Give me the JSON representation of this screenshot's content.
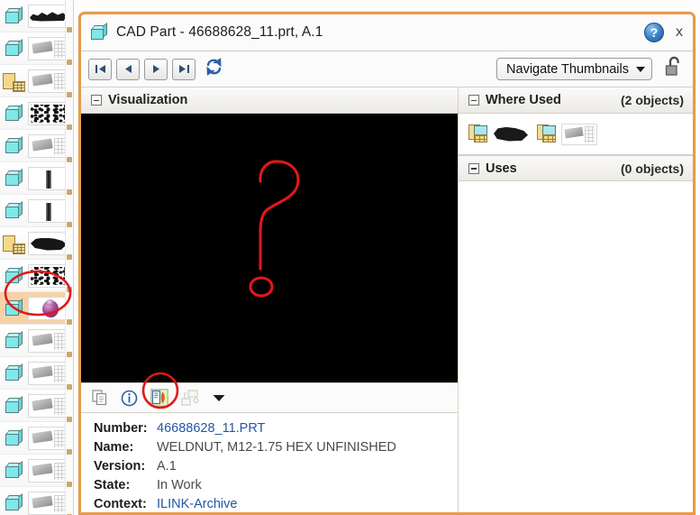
{
  "window": {
    "title": "CAD Part - 46688628_11.prt, A.1",
    "icon": "cad-part-cube-icon",
    "help_label": "?",
    "close_label": "×",
    "border_color": "#e89b4a"
  },
  "toolbar": {
    "buttons": [
      {
        "name": "first",
        "glyph": "first-record-icon"
      },
      {
        "name": "previous",
        "glyph": "previous-record-icon"
      },
      {
        "name": "next",
        "glyph": "next-record-icon"
      },
      {
        "name": "last",
        "glyph": "last-record-icon"
      }
    ],
    "refresh_icon": "refresh-icon",
    "select_label": "Navigate Thumbnails",
    "lock_icon": "unlocked-padlock-icon"
  },
  "visualization": {
    "header": "Visualization",
    "collapse_icon": "collapse-minus-icon",
    "canvas_background": "#000000",
    "annotation": "hand-drawn-red-question-mark",
    "annotation_color": "#e21717",
    "actions": [
      {
        "name": "copy",
        "icon": "copy-pages-icon"
      },
      {
        "name": "information",
        "icon": "info-circle-icon"
      },
      {
        "name": "open-viewer",
        "icon": "open-visualization-icon",
        "highlighted": true
      },
      {
        "name": "structure",
        "icon": "structure-compare-icon",
        "disabled": true
      },
      {
        "name": "more",
        "icon": "chevron-down-icon"
      }
    ]
  },
  "details": {
    "rows": [
      {
        "key": "Number:",
        "value": "46688628_11.PRT",
        "link": true
      },
      {
        "key": "Name:",
        "value": "WELDNUT, M12-1.75 HEX UNFINISHED",
        "link": false
      },
      {
        "key": "Version:",
        "value": "A.1",
        "link": false
      },
      {
        "key": "State:",
        "value": "In Work",
        "link": false
      },
      {
        "key": "Context:",
        "value": "ILINK-Archive",
        "link": true
      }
    ]
  },
  "where_used": {
    "header": "Where Used",
    "count": "(2 objects)",
    "collapse_icon": "collapse-minus-icon",
    "items": [
      {
        "name": "assembly-dark-thumbnail",
        "thumb": "dark"
      },
      {
        "name": "assembly-sheet-thumbnail",
        "thumb": "sheet"
      }
    ]
  },
  "uses": {
    "header": "Uses",
    "count": "(0 objects)",
    "collapse_icon": "collapse-minus-icon"
  },
  "sidebar": {
    "rows": [
      {
        "icon": "cube-icon",
        "thumb": "logo",
        "selected": false
      },
      {
        "icon": "cube-icon",
        "thumb": "sheet",
        "selected": false
      },
      {
        "icon": "folder-icon",
        "thumb": "sheet",
        "selected": false
      },
      {
        "icon": "cube-icon",
        "thumb": "speck",
        "selected": false
      },
      {
        "icon": "cube-icon",
        "thumb": "sheet",
        "selected": false
      },
      {
        "icon": "cube-icon",
        "thumb": "bolt",
        "selected": false
      },
      {
        "icon": "cube-icon",
        "thumb": "bolt",
        "selected": false
      },
      {
        "icon": "folder-icon",
        "thumb": "dark",
        "selected": false
      },
      {
        "icon": "bracket-icon",
        "thumb": "speck",
        "selected": false
      },
      {
        "icon": "cube-icon",
        "thumb": "purple",
        "selected": true
      },
      {
        "icon": "cube-icon",
        "thumb": "sheet",
        "selected": false
      },
      {
        "icon": "cube-icon",
        "thumb": "sheet",
        "selected": false
      },
      {
        "icon": "cube-icon",
        "thumb": "sheet",
        "selected": false
      },
      {
        "icon": "cube-icon",
        "thumb": "sheet",
        "selected": false
      },
      {
        "icon": "cube-icon",
        "thumb": "sheet",
        "selected": false
      },
      {
        "icon": "cube-icon",
        "thumb": "sheet",
        "selected": false
      }
    ],
    "selected_highlight_color": "#f6d2a6"
  },
  "annotations": {
    "circle_color": "#e21717",
    "marks": [
      {
        "name": "sidebar-selected-row-circle",
        "target": "sidebar selected row"
      },
      {
        "name": "open-visualization-icon-circle",
        "target": "visualization toolbar third icon"
      },
      {
        "name": "question-mark-scribble",
        "target": "visualization canvas"
      }
    ]
  }
}
